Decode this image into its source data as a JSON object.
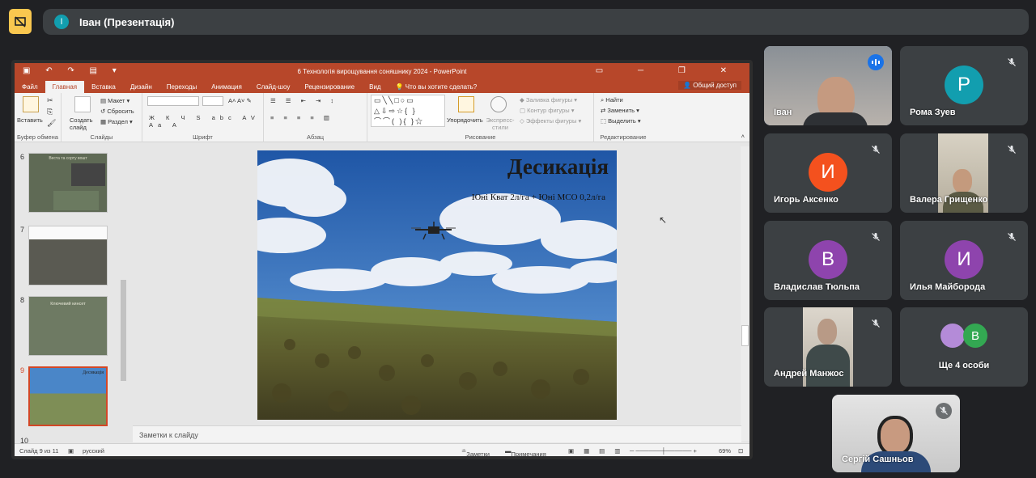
{
  "meet": {
    "presenter_initial": "I",
    "presenter_title": "Іван (Презентація)",
    "colors": {
      "bg": "#202124",
      "tile": "#3c4043",
      "present_icon": "#f9c74f",
      "active_border": "#8ab4f8"
    }
  },
  "powerpoint": {
    "window_title": "6 Технологія вирощування соняшнику 2024 - PowerPoint",
    "tabs": [
      "Файл",
      "Главная",
      "Вставка",
      "Дизайн",
      "Переходы",
      "Анимация",
      "Слайд-шоу",
      "Рецензирование",
      "Вид"
    ],
    "tell_me": "Что вы хотите сделать?",
    "share": "Общий доступ",
    "ribbon": {
      "paste": "Вставить",
      "clipboard": "Буфер обмена",
      "new_slide": "Создать слайд",
      "layout": "Макет",
      "reset": "Сбросить",
      "section": "Раздел",
      "slides": "Слайды",
      "font": "Шрифт",
      "paragraph": "Абзац",
      "arrange": "Упорядочить",
      "quick_styles": "Экспресс-стили",
      "shape_fill": "Заливка фигуры",
      "shape_outline": "Контур фигуры",
      "shape_effects": "Эффекты фигуры",
      "drawing": "Рисование",
      "find": "Найти",
      "replace": "Заменить",
      "select": "Выделить",
      "editing": "Редактирование"
    },
    "thumbnails": [
      {
        "num": "6",
        "title": "Веста та сорту вошт"
      },
      {
        "num": "7",
        "title": ""
      },
      {
        "num": "8",
        "title": "Ключевий кинсет"
      },
      {
        "num": "9",
        "title": "Десикація"
      },
      {
        "num": "10",
        "title": ""
      }
    ],
    "slide": {
      "title": "Десикація",
      "subtitle": "Юні Кват 2л/га + Юні МСО 0,2л/га"
    },
    "notes_placeholder": "Заметки к слайду",
    "status": {
      "slide_info": "Слайд 9 из 11",
      "language": "русский",
      "notes": "Заметки",
      "comments": "Примечания",
      "zoom": "69%"
    }
  },
  "participants": [
    {
      "name": "Іван",
      "type": "video",
      "speaking": true
    },
    {
      "name": "Рома Зуев",
      "initial": "Р",
      "color": "#129eaf",
      "muted": true
    },
    {
      "name": "Игорь Аксенко",
      "initial": "И",
      "color": "#f4511e",
      "muted": true
    },
    {
      "name": "Валера Грищенко",
      "type": "video",
      "muted": true
    },
    {
      "name": "Владислав Тюльпа",
      "initial": "В",
      "color": "#8e44ad",
      "muted": true
    },
    {
      "name": "Илья Майборода",
      "initial": "И",
      "color": "#8e44ad",
      "muted": true
    },
    {
      "name": "Андрей Манжос",
      "type": "video",
      "muted": true
    },
    {
      "name": "Ще 4 особи",
      "initial": "В",
      "color": "#33a852"
    },
    {
      "name": "Сергій Сашньов",
      "type": "video",
      "muted": true
    }
  ]
}
